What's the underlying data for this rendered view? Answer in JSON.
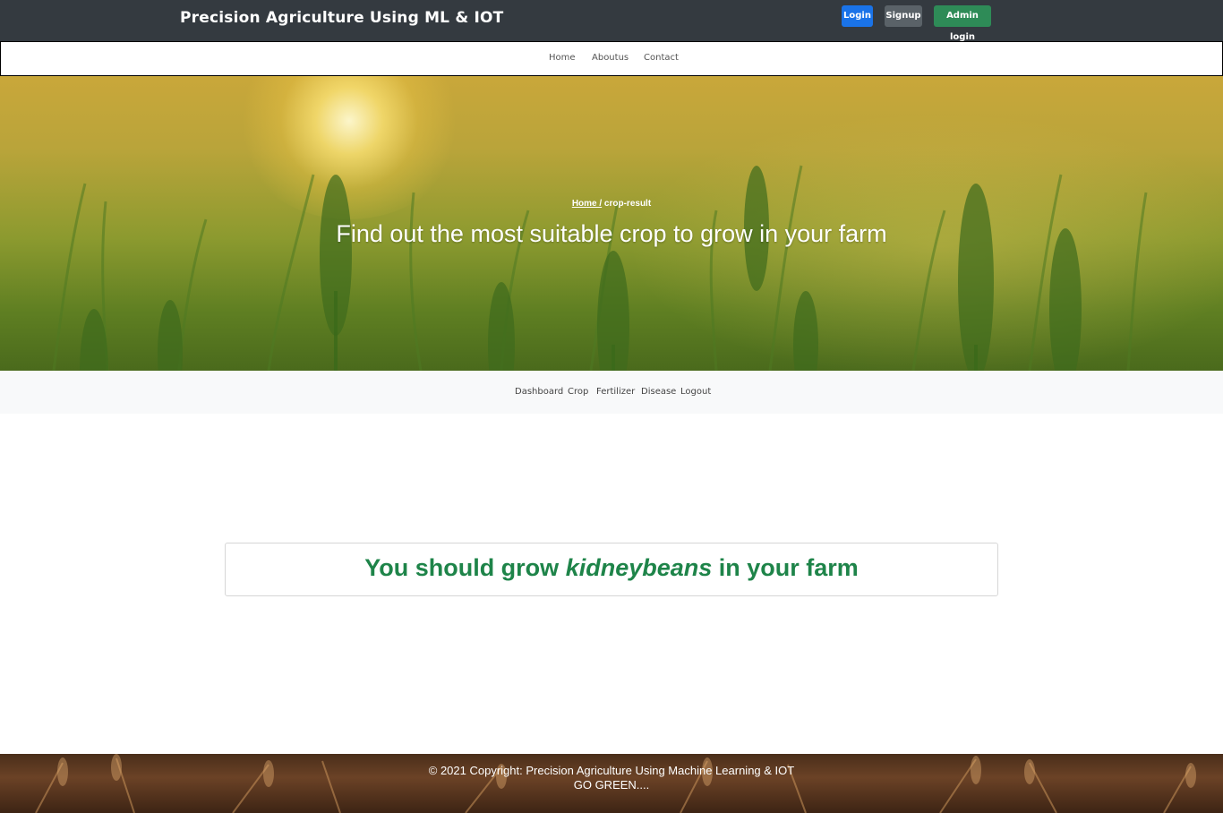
{
  "header": {
    "brand": "Precision Agriculture Using ML & IOT",
    "login_label": "Login",
    "signup_label": "Signup",
    "admin_login_label": "Admin login"
  },
  "main_nav": {
    "items": [
      {
        "label": "Home"
      },
      {
        "label": "Aboutus"
      },
      {
        "label": "Contact"
      }
    ]
  },
  "hero": {
    "breadcrumb_home": "Home /",
    "breadcrumb_current": " crop-result",
    "title": "Find out the most suitable crop to grow in your farm"
  },
  "sub_nav": {
    "items": [
      {
        "label": "Dashboard"
      },
      {
        "label": "Crop"
      },
      {
        "label": "Fertilizer"
      },
      {
        "label": "Disease"
      },
      {
        "label": "Logout"
      }
    ]
  },
  "result": {
    "prefix": "You should grow ",
    "crop": "kidneybeans",
    "suffix": " in your farm"
  },
  "footer": {
    "copyright": "© 2021 Copyright: Precision Agriculture Using Machine Learning & IOT",
    "tagline": "GO GREEN...."
  },
  "colors": {
    "topbar": "#343a40",
    "login_button": "#1a73e8",
    "signup_button": "#5a6268",
    "admin_button": "#2e8b57",
    "result_text": "#1e8449"
  }
}
